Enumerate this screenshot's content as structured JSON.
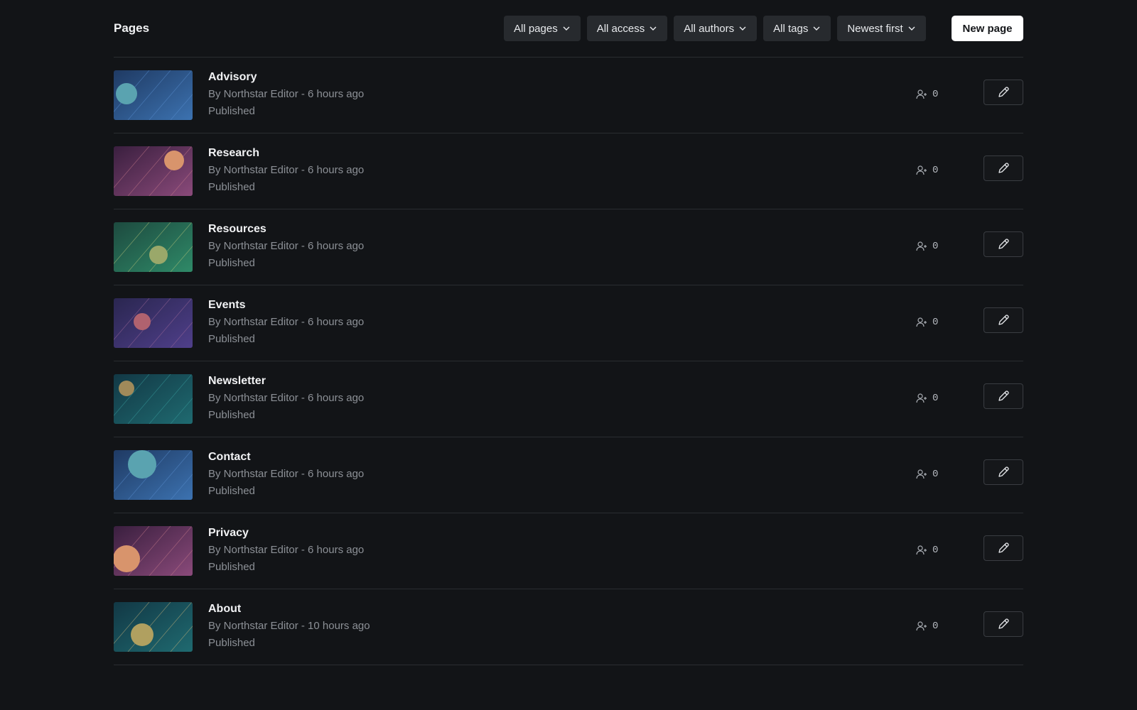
{
  "header": {
    "title": "Pages",
    "filters": [
      "All pages",
      "All access",
      "All authors",
      "All tags",
      "Newest first"
    ],
    "new_page_label": "New page"
  },
  "pages": [
    {
      "title": "Advisory",
      "meta": "By Northstar Editor - 6 hours ago",
      "status": "Published",
      "members": "0",
      "colors": [
        "#1f3a63",
        "#3c72b0",
        "#5aa3b0",
        "#5a8fd0"
      ]
    },
    {
      "title": "Research",
      "meta": "By Northstar Editor - 6 hours ago",
      "status": "Published",
      "colors": [
        "#3a1f3f",
        "#8a4a7a",
        "#d8946c",
        "#c77a8a"
      ],
      "members": "0"
    },
    {
      "title": "Resources",
      "meta": "By Northstar Editor - 6 hours ago",
      "status": "Published",
      "colors": [
        "#1d4a3f",
        "#2f8a68",
        "#9aa86a",
        "#b7c47a"
      ],
      "members": "0"
    },
    {
      "title": "Events",
      "meta": "By Northstar Editor - 6 hours ago",
      "status": "Published",
      "colors": [
        "#2a2650",
        "#4f3f8a",
        "#b0626f",
        "#a06a9a"
      ],
      "members": "0"
    },
    {
      "title": "Newsletter",
      "meta": "By Northstar Editor - 6 hours ago",
      "status": "Published",
      "colors": [
        "#123845",
        "#1f6a70",
        "#a08a5a",
        "#3aa0a0"
      ],
      "members": "0"
    },
    {
      "title": "Contact",
      "meta": "By Northstar Editor - 6 hours ago",
      "status": "Published",
      "colors": [
        "#1f3a63",
        "#3c72b0",
        "#5aa3b0",
        "#5a8fd0"
      ],
      "members": "0"
    },
    {
      "title": "Privacy",
      "meta": "By Northstar Editor - 6 hours ago",
      "status": "Published",
      "colors": [
        "#3a1f3f",
        "#8a4a7a",
        "#d8946c",
        "#c77a8a"
      ],
      "members": "0"
    },
    {
      "title": "About",
      "meta": "By Northstar Editor - 10 hours ago",
      "status": "Published",
      "colors": [
        "#123845",
        "#1f6a70",
        "#b0a060",
        "#c7b27a"
      ],
      "members": "0"
    }
  ],
  "icons": {
    "filter_chevron": "chevron-down-icon",
    "members": "add-user-icon",
    "edit": "pencil-icon"
  }
}
